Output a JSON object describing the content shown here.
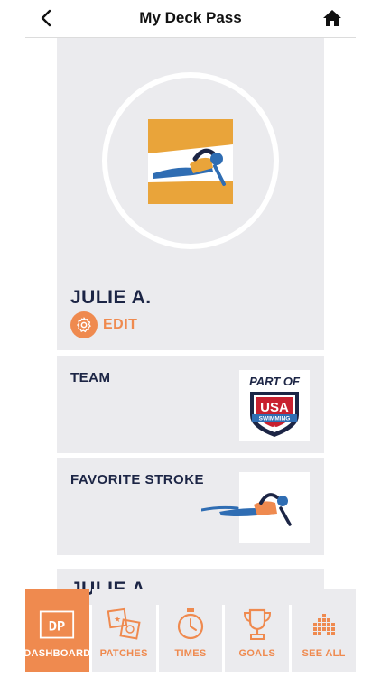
{
  "header": {
    "title": "My Deck Pass",
    "back_icon": "chevron-left-icon",
    "home_icon": "home-icon"
  },
  "profile": {
    "name": "JULIE A.",
    "edit_label": "EDIT",
    "avatar_icon": "swimmer-badge-icon"
  },
  "team_card": {
    "label": "TEAM",
    "logo_text_line1": "PART OF",
    "logo_text_line2": "USA",
    "logo_text_line3": "SWIMMING"
  },
  "stroke_card": {
    "label": "FAVORITE STROKE",
    "icon": "freestyle-swimmer-icon"
  },
  "next_card": {
    "name": "JULIE A."
  },
  "tabs": [
    {
      "label": "DASHBOARD",
      "icon": "dp-logo-icon",
      "active": true
    },
    {
      "label": "PATCHES",
      "icon": "patches-icon",
      "active": false
    },
    {
      "label": "TIMES",
      "icon": "stopwatch-icon",
      "active": false
    },
    {
      "label": "GOALS",
      "icon": "trophy-icon",
      "active": false
    },
    {
      "label": "SEE ALL",
      "icon": "grid-pyramid-icon",
      "active": false
    }
  ],
  "colors": {
    "accent": "#ef8a4f",
    "navy": "#1c2545",
    "card": "#ebebee",
    "blue": "#2f6db3",
    "gold": "#e9a43a"
  }
}
